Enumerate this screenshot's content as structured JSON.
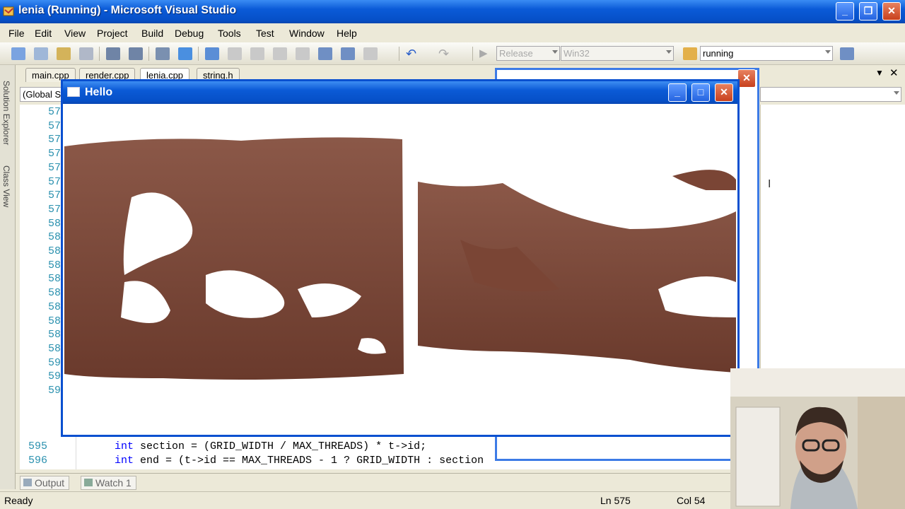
{
  "window": {
    "title": "lenia (Running) - Microsoft Visual Studio"
  },
  "menu": [
    "File",
    "Edit",
    "View",
    "Project",
    "Build",
    "Debug",
    "Tools",
    "Test",
    "Window",
    "Help"
  ],
  "toolbar": {
    "config": "Release",
    "platform": "Win32",
    "find_value": "running"
  },
  "doc_tabs": [
    "main.cpp",
    "render.cpp",
    "lenia.cpp",
    "string.h"
  ],
  "scope_combo": "(Global S",
  "side_tabs": {
    "solution_explorer": "Solution Explorer",
    "class_view": "Class View"
  },
  "line_numbers_partial": [
    "57",
    "57",
    "57",
    "57",
    "57",
    "57",
    "57",
    "57",
    "58",
    "58",
    "58",
    "58",
    "58",
    "58",
    "58",
    "58",
    "58",
    "58",
    "59",
    "59",
    "59"
  ],
  "code": {
    "line_595": {
      "num": "595",
      "kw": "int",
      "rest": " section = (GRID_WIDTH / MAX_THREADS) * t->id;"
    },
    "line_596": {
      "num": "596",
      "kw": "int",
      "rest": " end = (t->id == MAX_THREADS - 1 ? GRID_WIDTH : section"
    }
  },
  "hello_window": {
    "title": "Hello"
  },
  "bottom_tabs": {
    "output": "Output",
    "watch": "Watch 1"
  },
  "status": {
    "text": "Ready",
    "ln": "Ln 575",
    "col": "Col 54"
  },
  "colors": {
    "title_blue": "#0a5ad7",
    "render_surface": "#7a4535"
  }
}
